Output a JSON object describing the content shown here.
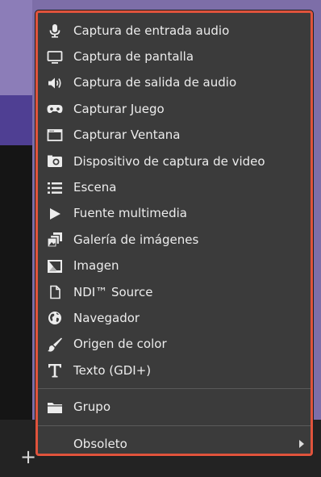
{
  "menu": {
    "items": [
      {
        "label": "Captura de entrada audio",
        "icon": "microphone-icon"
      },
      {
        "label": "Captura de pantalla",
        "icon": "monitor-icon"
      },
      {
        "label": "Captura de salida de audio",
        "icon": "speaker-icon"
      },
      {
        "label": "Capturar Juego",
        "icon": "gamepad-icon"
      },
      {
        "label": "Capturar Ventana",
        "icon": "window-icon"
      },
      {
        "label": "Dispositivo de captura de video",
        "icon": "camera-icon"
      },
      {
        "label": "Escena",
        "icon": "list-icon"
      },
      {
        "label": "Fuente multimedia",
        "icon": "play-icon"
      },
      {
        "label": "Galería de imágenes",
        "icon": "gallery-icon"
      },
      {
        "label": "Imagen",
        "icon": "image-icon"
      },
      {
        "label": "NDI™ Source",
        "icon": "file-icon"
      },
      {
        "label": "Navegador",
        "icon": "globe-icon"
      },
      {
        "label": "Origen de color",
        "icon": "brush-icon"
      },
      {
        "label": "Texto (GDI+)",
        "icon": "text-icon"
      }
    ],
    "group": {
      "label": "Grupo",
      "icon": "folder-icon"
    },
    "deprecated": {
      "label": "Obsoleto",
      "icon": "chevron-right-icon"
    }
  },
  "colors": {
    "menu_bg": "#3b3b3b",
    "highlight_border": "#e0533c",
    "text": "#ececec"
  },
  "background": {
    "add_symbol": "+"
  }
}
